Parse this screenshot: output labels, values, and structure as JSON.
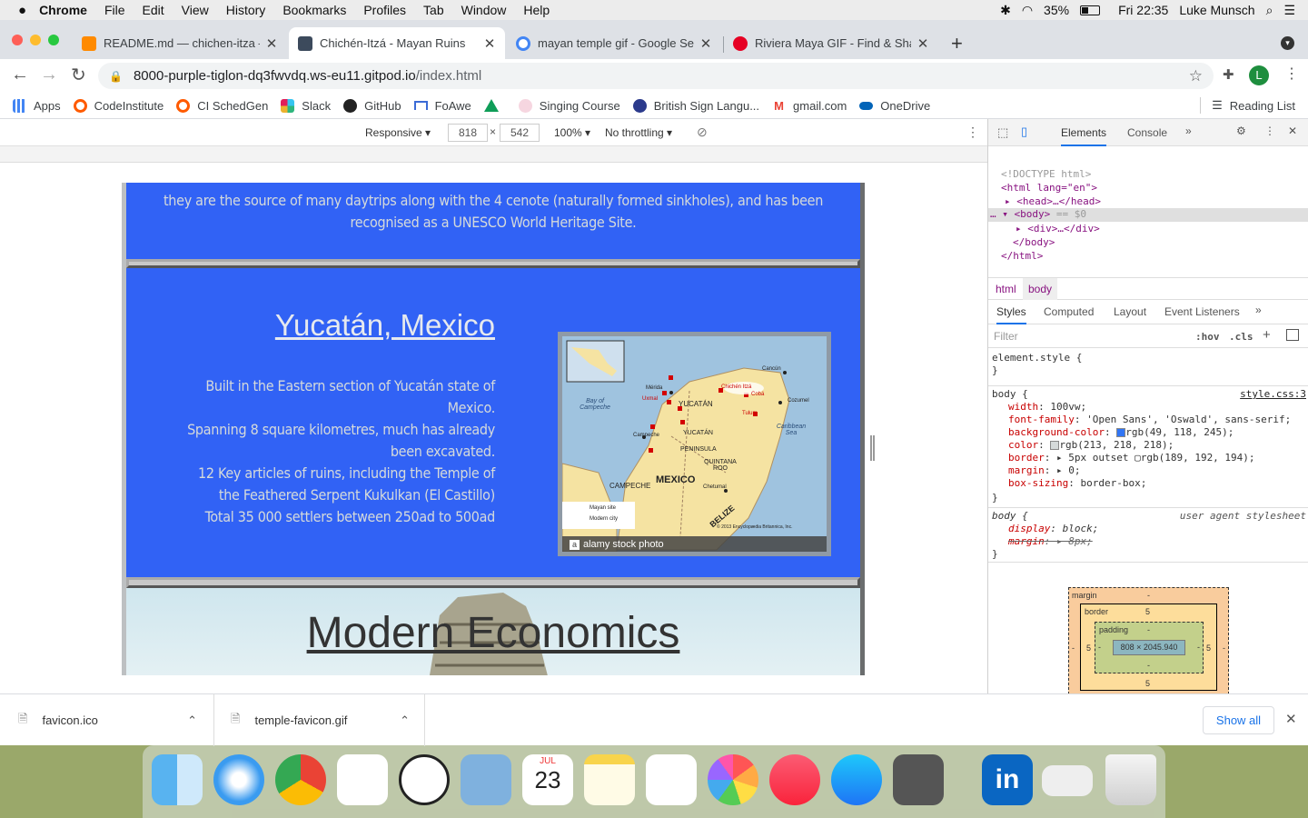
{
  "menubar": {
    "apple_icon": "apple-icon",
    "app": "Chrome",
    "items": [
      "File",
      "Edit",
      "View",
      "History",
      "Bookmarks",
      "Profiles",
      "Tab",
      "Window",
      "Help"
    ],
    "battery": "35%",
    "datetime": "Fri 22:35",
    "user": "Luke Munsch"
  },
  "tabs": [
    {
      "title": "README.md — chichen-itza — ",
      "icon_color": "#ff8a00"
    },
    {
      "title": "Chichén-Itzá - Mayan Ruins",
      "icon_color": "#3c4a5c"
    },
    {
      "title": "mayan temple gif - Google Sea",
      "icon_color": "#4285f4"
    },
    {
      "title": "Riviera Maya GIF - Find & Shar",
      "icon_color": "#e60023"
    }
  ],
  "address": {
    "url_host": "8000-purple-tiglon-dq3fwvdq.ws-eu11.gitpod.io",
    "url_path": "/index.html"
  },
  "profile_initial": "L",
  "bookmarks": [
    {
      "label": "Apps",
      "color": "#4285f4"
    },
    {
      "label": "CodeInstitute",
      "color": "#ff5a00"
    },
    {
      "label": "CI SchedGen",
      "color": "#ff5a00"
    },
    {
      "label": "Slack",
      "color": "#4a154b"
    },
    {
      "label": "GitHub",
      "color": "#222222"
    },
    {
      "label": "FoAwe",
      "color": "#3b6bd6"
    },
    {
      "label": "",
      "color": "#0f9d58"
    },
    {
      "label": "Singing Course",
      "color": "#b03060"
    },
    {
      "label": "British Sign Langu...",
      "color": "#2b3a8c"
    },
    {
      "label": "gmail.com",
      "color": "#ea4335"
    },
    {
      "label": "OneDrive",
      "color": "#0364b8"
    }
  ],
  "reading_list": "Reading List",
  "responsive": {
    "mode": "Responsive",
    "width": "818",
    "height": "542",
    "zoom": "100%",
    "throttling": "No throttling"
  },
  "site": {
    "intro_text": "they are the source of many daytrips along with the 4 cenote (naturally formed sinkholes), and has been recognised as a UNESCO World Heritage Site.",
    "section_title": "Yucatán, Mexico",
    "desc_lines": [
      "Built in the Eastern section of Yucatán state of Mexico.",
      "Spanning 8 square kilometres, much has already been excavated.",
      "12 Key articles of ruins, including the Temple of the Feathered Serpent Kukulkan (El Castillo)",
      "Total 35 000 settlers between 250ad to 500ad"
    ],
    "map_watermark": "alamy stock photo",
    "map_labels": {
      "mexico": "MEXICO",
      "yucatan": "YUCATÁN",
      "belize": "BELIZE",
      "campeche": "CAMPECHE",
      "quintana_roo": "QUINTANA ROO",
      "caribbean": "Caribbean Sea",
      "bay": "Bay of Campeche",
      "chichen": "Chichén Itzá",
      "merida": "Mérida",
      "cancun": "Cancún",
      "cozumel": "Cozumel",
      "tulum": "Tulum",
      "uxmal": "Uxmal",
      "coba": "Cobá",
      "chetumal": "Chetumal",
      "campeche_city": "Campeche",
      "peninsula": "PENINSULA",
      "legend_site": "Mayan site",
      "legend_city": "Modern city",
      "copyright": "© 2013 Encyclopædia Britannica, Inc."
    },
    "next_title": "Modern Economics"
  },
  "devtools": {
    "tabs": [
      "Elements",
      "Console"
    ],
    "dom": {
      "doctype": "<!DOCTYPE html>",
      "html_open": "<html lang=\"en\">",
      "head": "<head>…</head>",
      "body_open": "<body>",
      "body_marker": "== $0",
      "div": "<div>…</div>",
      "body_close": "</body>",
      "html_close": "</html>"
    },
    "crumbs": [
      "html",
      "body"
    ],
    "style_tabs": [
      "Styles",
      "Computed",
      "Layout",
      "Event Listeners"
    ],
    "filter_placeholder": "Filter",
    "hov": ":hov",
    "cls": ".cls",
    "element_style": "element.style {",
    "rule1_selector": "body {",
    "rule1_source": "style.css:3",
    "rule1_props": [
      {
        "name": "width",
        "value": "100vw;"
      },
      {
        "name": "font-family",
        "value": "'Open Sans', 'Oswald', sans-serif;"
      },
      {
        "name": "background-color",
        "value": "rgb(49, 118, 245);",
        "swatch": "#3176f5"
      },
      {
        "name": "color",
        "value": "rgb(213, 218, 218);",
        "swatch": "#d5dada"
      },
      {
        "name": "border",
        "value": "▸ 5px outset ▢rgb(189, 192, 194);"
      },
      {
        "name": "margin",
        "value": "▸ 0;"
      },
      {
        "name": "box-sizing",
        "value": "border-box;"
      }
    ],
    "rule2_selector": "body {",
    "rule2_source": "user agent stylesheet",
    "rule2_props": [
      {
        "name": "display",
        "value": "block;"
      },
      {
        "name": "margin",
        "value": "▸ 8px;"
      }
    ],
    "boxmodel": {
      "margin": "margin",
      "border": "border",
      "padding": "padding",
      "dash": "-",
      "border_val": "5",
      "content": "808 × 2045.940"
    }
  },
  "downloads": [
    {
      "name": "favicon.ico"
    },
    {
      "name": "temple-favicon.gif"
    }
  ],
  "show_all": "Show all",
  "dock_calendar": {
    "month": "JUL",
    "day": "23"
  }
}
